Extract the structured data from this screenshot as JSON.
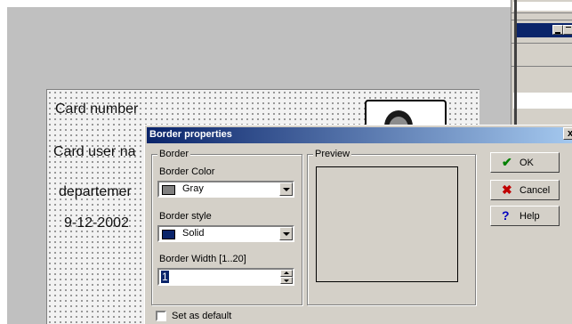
{
  "card": {
    "fields": [
      "Card number",
      "Card user na",
      "departemer",
      "9-12-2002"
    ]
  },
  "dialog": {
    "title": "Border properties",
    "close_glyph": "x",
    "border_group": {
      "title": "Border",
      "color_label": "Border Color",
      "color_value": "Gray",
      "color_swatch": "#808080",
      "style_label": "Border style",
      "style_value": "Solid",
      "style_swatch": "#0a246a",
      "width_label": "Border Width [1..20]",
      "width_value": "1"
    },
    "preview_group": {
      "title": "Preview"
    },
    "buttons": {
      "ok": "OK",
      "cancel": "Cancel",
      "help": "Help"
    },
    "set_default_label": "Set as default"
  },
  "colors": {
    "title_active": "#0a246a",
    "dialog_face": "#d4d0c8",
    "ok_icon": "#008000",
    "cancel_icon": "#c00000",
    "help_icon": "#0000c0"
  },
  "icons": {
    "ok": "check-icon",
    "cancel": "x-mark-icon",
    "help": "question-icon"
  }
}
